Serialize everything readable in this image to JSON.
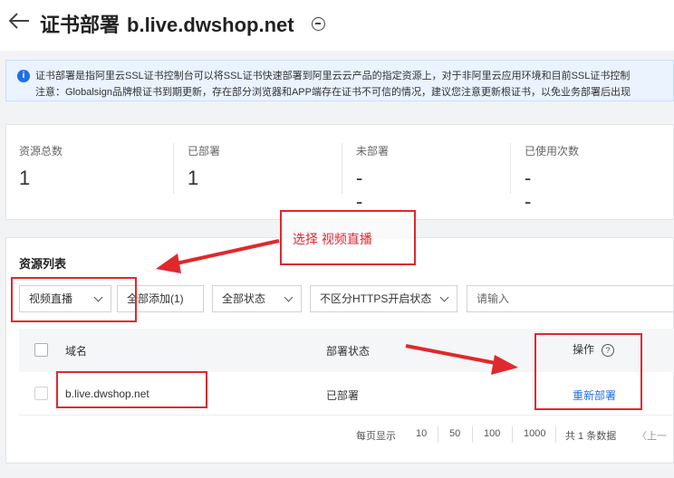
{
  "header": {
    "title": "证书部署",
    "domain": "b.live.dwshop.net"
  },
  "notice": {
    "line1": "证书部署是指阿里云SSL证书控制台可以将SSL证书快速部署到阿里云云产品的指定资源上，对于非阿里云应用环境和目前SSL证书控制",
    "line2": "注意：Globalsign品牌根证书到期更新，存在部分浏览器和APP端存在证书不可信的情况，建议您注意更新根证书，以免业务部署后出现"
  },
  "stats": [
    {
      "label": "资源总数",
      "value": "1"
    },
    {
      "label": "已部署",
      "value": "1"
    },
    {
      "label": "未部署",
      "value": "--"
    },
    {
      "label": "已使用次数",
      "value": "--"
    }
  ],
  "list": {
    "title": "资源列表",
    "filters": {
      "product": "视频直播",
      "add_all": "全部添加(1)",
      "status": "全部状态",
      "https": "不区分HTTPS开启状态",
      "search_placeholder": "请输入"
    },
    "columns": {
      "domain": "域名",
      "status": "部署状态",
      "action": "操作"
    },
    "rows": [
      {
        "domain": "b.live.dwshop.net",
        "status": "已部署",
        "action": "重新部署"
      }
    ],
    "pagination": {
      "per_page_label": "每页显示",
      "sizes": [
        "10",
        "50",
        "100",
        "1000"
      ],
      "total": "共 1 条数据",
      "prev": "〈上一"
    }
  },
  "annotation": {
    "callout": "选择 视频直播"
  },
  "colors": {
    "accent": "#1f6fe5",
    "annotation_red": "#e0282e"
  }
}
